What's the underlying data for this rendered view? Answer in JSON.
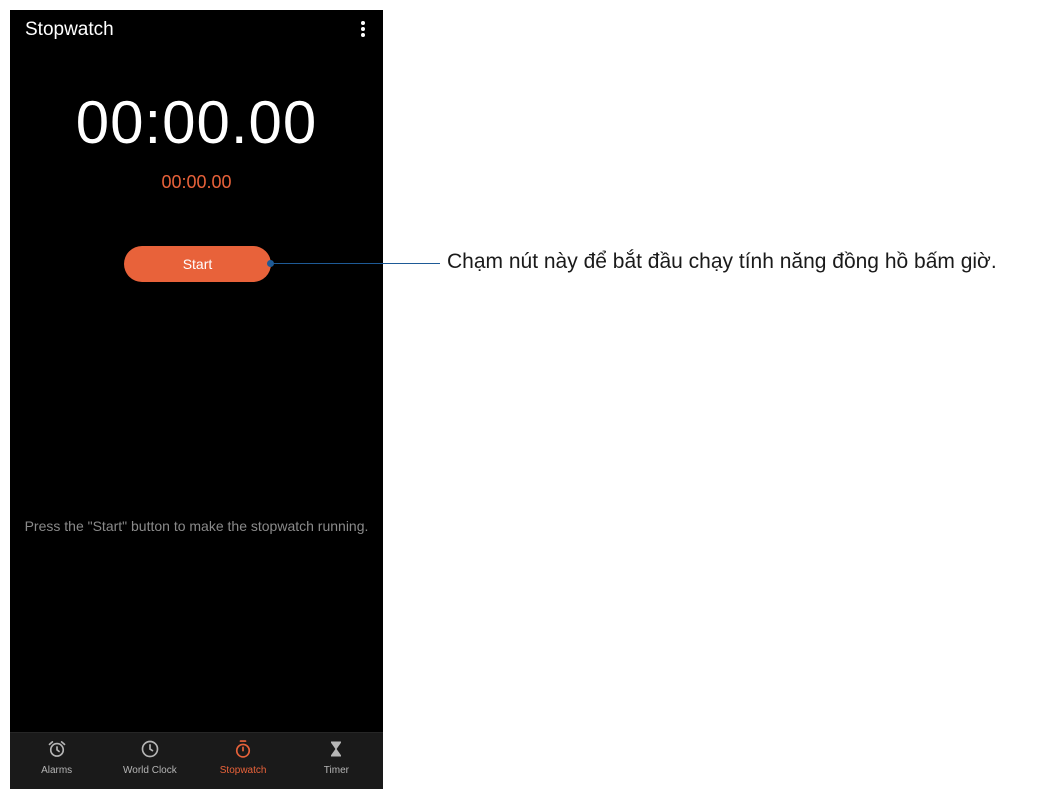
{
  "app": {
    "title": "Stopwatch",
    "more_icon": "more-vert-icon"
  },
  "stopwatch": {
    "main_time": "00:00.00",
    "lap_time": "00:00.00",
    "start_label": "Start",
    "hint": "Press the \"Start\" button to make the stopwatch running."
  },
  "nav": {
    "items": [
      {
        "label": "Alarms",
        "icon": "alarm-clock-icon",
        "active": false
      },
      {
        "label": "World Clock",
        "icon": "clock-icon",
        "active": false
      },
      {
        "label": "Stopwatch",
        "icon": "stopwatch-icon",
        "active": true
      },
      {
        "label": "Timer",
        "icon": "hourglass-icon",
        "active": false
      }
    ]
  },
  "callout": {
    "text": "Chạm nút này để bắt đầu chạy tính năng đồng hồ bấm giờ."
  },
  "colors": {
    "accent": "#e8623a",
    "background": "#000000",
    "callout_line": "#1e5a96"
  }
}
